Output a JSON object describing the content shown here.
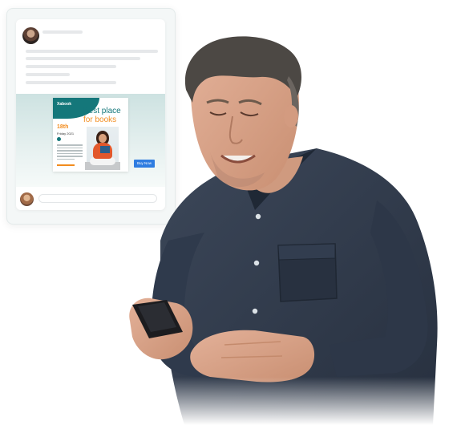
{
  "post": {
    "ad": {
      "logo": "Xabook",
      "headline_line1": "Best place",
      "headline_line2": "for books",
      "date": "18th",
      "day": "Friday 2021",
      "cta_label": "Buy Now",
      "colors": {
        "teal": "#14777a",
        "orange": "#f28c1e",
        "button": "#2f7de1"
      }
    },
    "comment_input": {
      "value": "",
      "placeholder": ""
    }
  },
  "scene": {
    "subject": "smiling man using phone",
    "shirt_color": "#2f3a4c"
  }
}
